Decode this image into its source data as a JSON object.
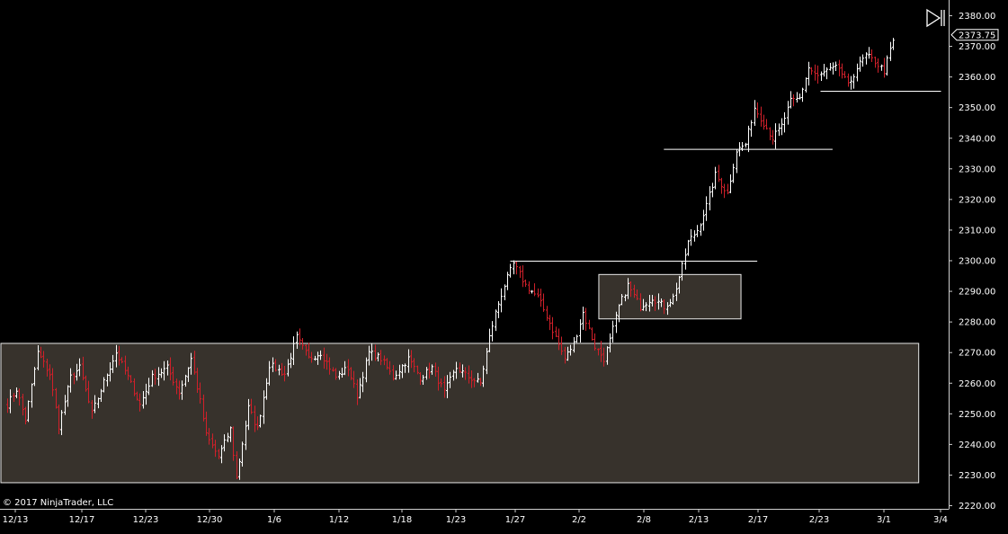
{
  "copyright": "© 2017 NinjaTrader, LLC",
  "current_price_label": "2373.75",
  "colors": {
    "background": "#000000",
    "up_bar": "#ffffff",
    "down_bar": "#d0202a",
    "zone_fill": "#37322c",
    "zone_border": "#e8e8e8",
    "line": "#ffffff"
  },
  "icons": {
    "play": "play-end-icon"
  },
  "chart_data": {
    "type": "ohlc",
    "ylim": [
      2220,
      2380
    ],
    "y_ticks": [
      "2220.00",
      "2230.00",
      "2240.00",
      "2250.00",
      "2260.00",
      "2270.00",
      "2280.00",
      "2290.00",
      "2300.00",
      "2310.00",
      "2320.00",
      "2330.00",
      "2340.00",
      "2350.00",
      "2360.00",
      "2370.00",
      "2380.00"
    ],
    "x_ticks": [
      "12/13",
      "12/17",
      "12/23",
      "12/30",
      "1/6",
      "1/12",
      "1/18",
      "1/23",
      "1/27",
      "2/2",
      "2/8",
      "2/13",
      "2/17",
      "2/23",
      "3/1",
      "3/4"
    ],
    "zones": [
      {
        "from_index": 0,
        "to_index": 302,
        "low": 2227.5,
        "high": 2273
      },
      {
        "from_index": 197,
        "to_index": 243,
        "low": 2281,
        "high": 2295.5
      }
    ],
    "hlines": [
      {
        "from_index": 167,
        "to_index": 249,
        "price": 2300
      },
      {
        "from_index": 218,
        "to_index": 274,
        "price": 2336.5
      },
      {
        "from_index": 270,
        "to_index": 310,
        "price": 2355.5
      }
    ],
    "anchors": [
      [
        0,
        2253
      ],
      [
        3,
        2258
      ],
      [
        6,
        2248
      ],
      [
        10,
        2270
      ],
      [
        14,
        2263
      ],
      [
        17,
        2246
      ],
      [
        21,
        2262
      ],
      [
        24,
        2265
      ],
      [
        28,
        2250
      ],
      [
        33,
        2263
      ],
      [
        36,
        2270
      ],
      [
        40,
        2262
      ],
      [
        44,
        2253
      ],
      [
        48,
        2262
      ],
      [
        53,
        2265
      ],
      [
        57,
        2257
      ],
      [
        61,
        2268
      ],
      [
        64,
        2254
      ],
      [
        66,
        2243
      ],
      [
        70,
        2236
      ],
      [
        74,
        2245
      ],
      [
        76,
        2229
      ],
      [
        80,
        2252
      ],
      [
        83,
        2245
      ],
      [
        87,
        2266
      ],
      [
        92,
        2263
      ],
      [
        96,
        2275
      ],
      [
        100,
        2268
      ],
      [
        104,
        2270
      ],
      [
        109,
        2262
      ],
      [
        113,
        2265
      ],
      [
        116,
        2256
      ],
      [
        120,
        2270
      ],
      [
        124,
        2268
      ],
      [
        128,
        2262
      ],
      [
        133,
        2268
      ],
      [
        137,
        2262
      ],
      [
        141,
        2265
      ],
      [
        145,
        2257
      ],
      [
        149,
        2265
      ],
      [
        153,
        2262
      ],
      [
        157,
        2260
      ],
      [
        160,
        2275
      ],
      [
        162,
        2283
      ],
      [
        165,
        2292
      ],
      [
        168,
        2299
      ],
      [
        172,
        2292
      ],
      [
        176,
        2288
      ],
      [
        179,
        2282
      ],
      [
        182,
        2275
      ],
      [
        185,
        2268
      ],
      [
        188,
        2273
      ],
      [
        191,
        2283
      ],
      [
        195,
        2272
      ],
      [
        198,
        2268
      ],
      [
        200,
        2274
      ],
      [
        203,
        2285
      ],
      [
        206,
        2292
      ],
      [
        210,
        2285
      ],
      [
        214,
        2288
      ],
      [
        218,
        2285
      ],
      [
        221,
        2288
      ],
      [
        224,
        2298
      ],
      [
        226,
        2306
      ],
      [
        229,
        2310
      ],
      [
        232,
        2318
      ],
      [
        235,
        2328
      ],
      [
        239,
        2322
      ],
      [
        242,
        2336
      ],
      [
        245,
        2338
      ],
      [
        248,
        2350
      ],
      [
        251,
        2345
      ],
      [
        254,
        2340
      ],
      [
        257,
        2344
      ],
      [
        260,
        2352
      ],
      [
        263,
        2353
      ],
      [
        266,
        2363
      ],
      [
        269,
        2360
      ],
      [
        272,
        2362
      ],
      [
        276,
        2363
      ],
      [
        279,
        2357
      ],
      [
        282,
        2363
      ],
      [
        285,
        2367
      ],
      [
        288,
        2365
      ],
      [
        291,
        2362
      ],
      [
        294,
        2372
      ]
    ],
    "last_price": 2373.75
  }
}
